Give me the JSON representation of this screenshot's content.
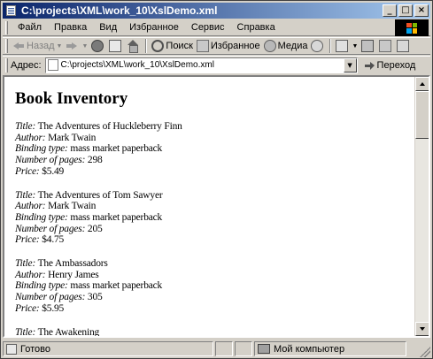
{
  "window": {
    "title": "C:\\projects\\XML\\work_10\\XslDemo.xml",
    "controls": {
      "minimize": "_",
      "maximize": "□",
      "close": "×"
    }
  },
  "menubar": {
    "items": [
      {
        "label": "Файл"
      },
      {
        "label": "Правка"
      },
      {
        "label": "Вид"
      },
      {
        "label": "Избранное"
      },
      {
        "label": "Сервис"
      },
      {
        "label": "Справка"
      }
    ]
  },
  "toolbar": {
    "back_label": "Назад",
    "search_label": "Поиск",
    "favorites_label": "Избранное",
    "media_label": "Медиа",
    "dropdown_glyph": "▼"
  },
  "addressbar": {
    "label": "Адрес:",
    "value": "C:\\projects\\XML\\work_10\\XslDemo.xml",
    "go_label": "Переход"
  },
  "page": {
    "heading": "Book Inventory",
    "labels": {
      "title": "Title:",
      "author": "Author:",
      "binding": "Binding type:",
      "pages": "Number of pages:",
      "price": "Price:"
    },
    "books": [
      {
        "title": "The Adventures of Huckleberry Finn",
        "author": "Mark Twain",
        "binding": "mass market paperback",
        "pages": "298",
        "price": "$5.49"
      },
      {
        "title": "The Adventures of Tom Sawyer",
        "author": "Mark Twain",
        "binding": "mass market paperback",
        "pages": "205",
        "price": "$4.75"
      },
      {
        "title": "The Ambassadors",
        "author": "Henry James",
        "binding": "mass market paperback",
        "pages": "305",
        "price": "$5.95"
      },
      {
        "title": "The Awakening",
        "author": "",
        "binding": "",
        "pages": "",
        "price": ""
      }
    ]
  },
  "statusbar": {
    "text": "Готово",
    "zone": "Мой компьютер"
  },
  "colors": {
    "titlebar_start": "#0a246a",
    "titlebar_end": "#a6caf0",
    "chrome": "#d4d0c8"
  }
}
